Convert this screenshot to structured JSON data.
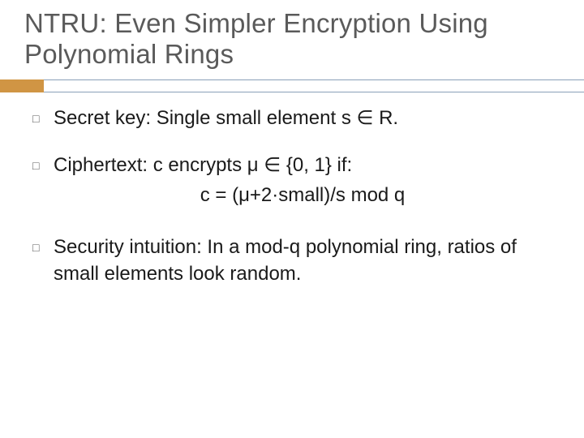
{
  "title": "NTRU: Even Simpler Encryption Using Polynomial Rings",
  "bullets": {
    "b0": "Secret key: Single small element s ∈ R.",
    "b1": "Ciphertext: c encrypts μ ∈ {0, 1} if:",
    "b1_formula": "c = (μ+2·small)/s mod q",
    "b2": "Security intuition: In a mod-q polynomial ring, ratios of small elements look random."
  },
  "bullet_glyph": "□"
}
